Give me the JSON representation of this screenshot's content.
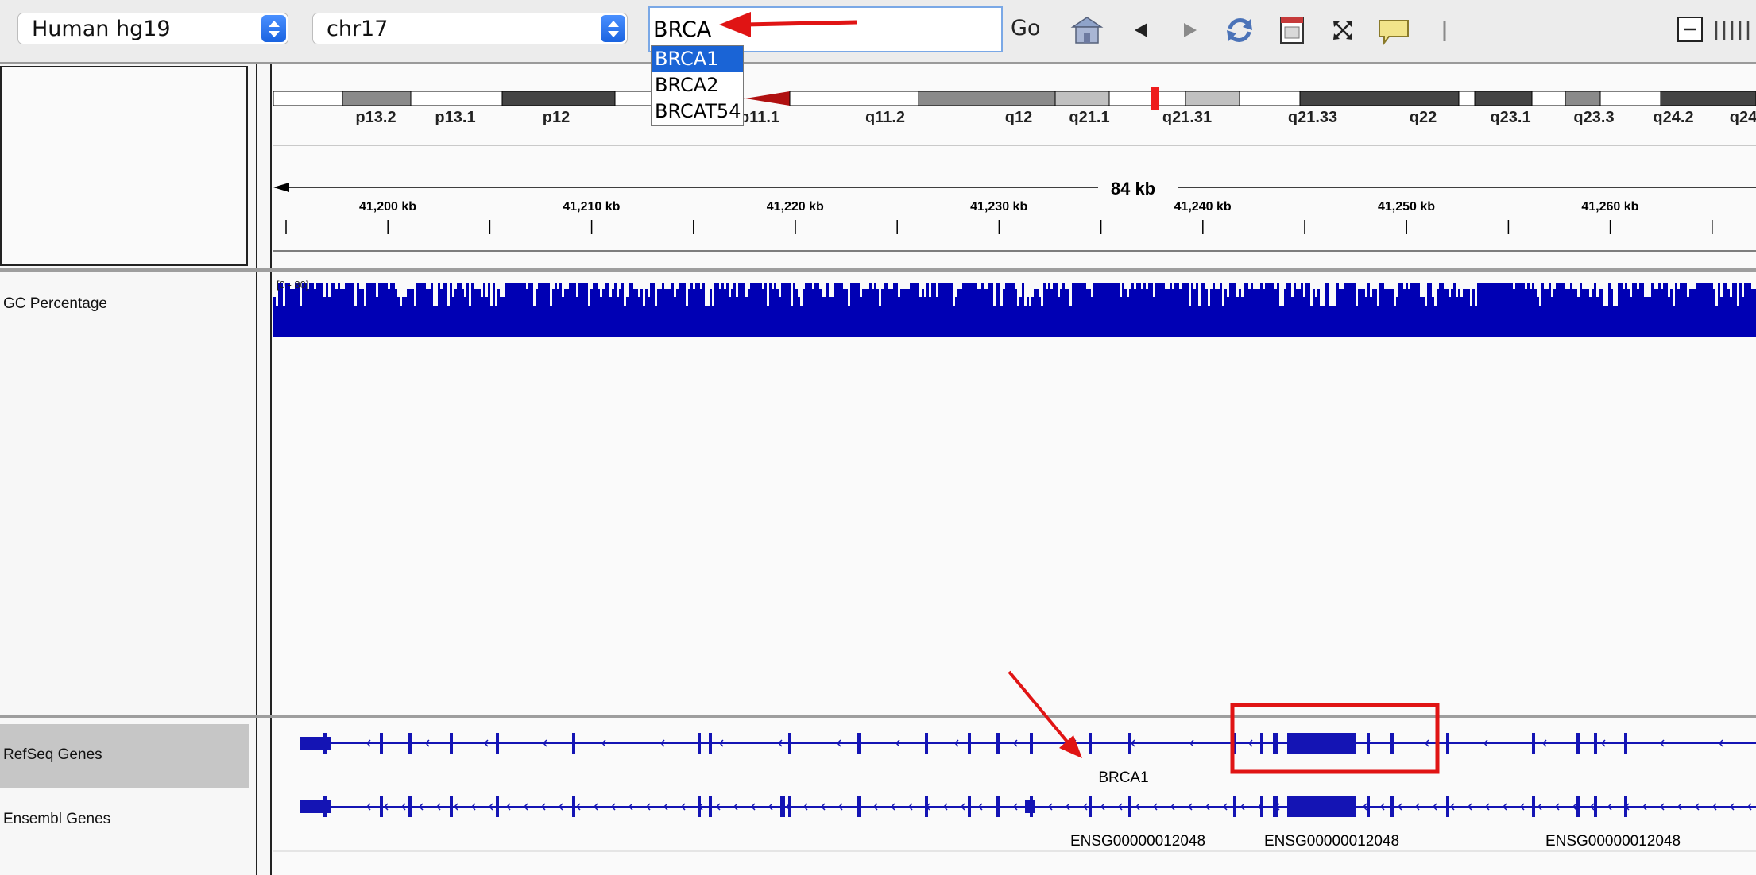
{
  "toolbar": {
    "genome_select": "Human hg19",
    "chromosome_select": "chr17",
    "locus_value": "BRCA",
    "go_label": "Go",
    "icons": [
      "home-icon",
      "back-icon",
      "forward-icon",
      "refresh-icon",
      "region-of-interest-icon",
      "fit-to-window-icon",
      "popup-info-icon",
      "ruler-toggle-icon",
      "zoom-out-icon",
      "zoom-level-icon"
    ]
  },
  "autocomplete": {
    "options": [
      {
        "label": "BRCA1",
        "selected": true
      },
      {
        "label": "BRCA2",
        "selected": false
      },
      {
        "label": "BRCAT54",
        "selected": false
      }
    ]
  },
  "ideogram": {
    "bands": [
      "p13.2",
      "p13.1",
      "p12",
      "p11.1",
      "q11.2",
      "q12",
      "q21.1",
      "q21.31",
      "q21.33",
      "q22",
      "q23.1",
      "q23.3",
      "q24.2",
      "q24"
    ]
  },
  "ruler": {
    "span_label": "84 kb",
    "ticks": [
      "41,200 kb",
      "41,210 kb",
      "41,220 kb",
      "41,230 kb",
      "41,240 kb",
      "41,250 kb",
      "41,260 kb"
    ]
  },
  "tracks": {
    "gc": {
      "name": "GC Percentage",
      "range": "[0 - 80]",
      "color": "#0000b4"
    },
    "refseq": {
      "name": "RefSeq Genes",
      "gene_label": "BRCA1"
    },
    "ensembl": {
      "name": "Ensembl Genes",
      "gene_labels": [
        "ENSG00000012048",
        "ENSG00000012048",
        "ENSG00000012048"
      ]
    }
  },
  "colors": {
    "gene": "#1414b4",
    "annotation": "#e01414",
    "toolbar": "#ececec"
  }
}
